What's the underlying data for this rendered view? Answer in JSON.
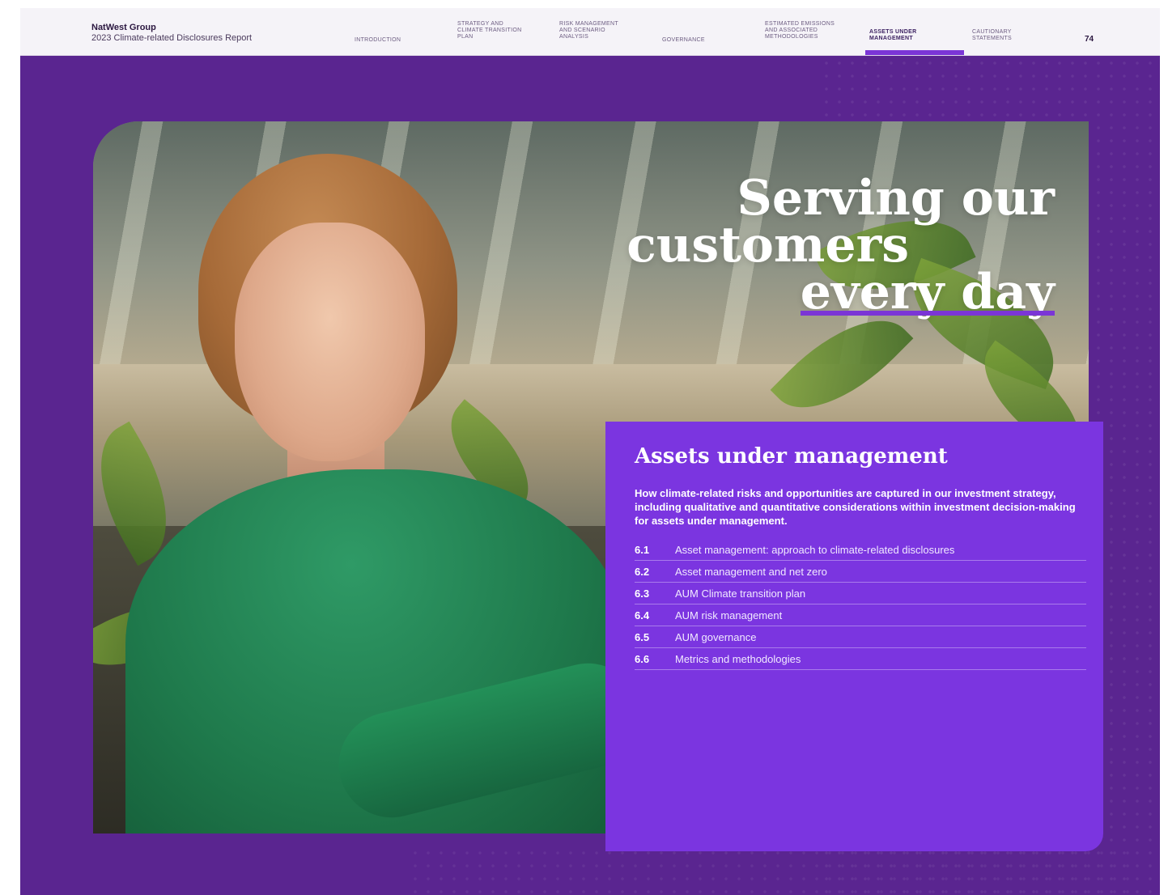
{
  "header": {
    "brand_name": "NatWest Group",
    "report_title": "2023 Climate-related Disclosures Report",
    "page_number": "74",
    "nav": [
      {
        "label": "INTRODUCTION",
        "active": false
      },
      {
        "label": "STRATEGY AND\nCLIMATE TRANSITION\nPLAN",
        "active": false
      },
      {
        "label": "RISK MANAGEMENT\nAND SCENARIO\nANALYSIS",
        "active": false
      },
      {
        "label": "GOVERNANCE",
        "active": false
      },
      {
        "label": "ESTIMATED EMISSIONS\nAND ASSOCIATED\nMETHODOLOGIES",
        "active": false
      },
      {
        "label": "ASSETS UNDER\nMANAGEMENT",
        "active": true
      },
      {
        "label": "CAUTIONARY\nSTATEMENTS",
        "active": false
      }
    ]
  },
  "hero": {
    "headline_line1": "Serving our",
    "headline_line2": "customers",
    "headline_line3": "every day"
  },
  "section": {
    "title": "Assets under management",
    "intro": "How climate-related risks and opportunities are captured in our investment strategy, including qualitative and quantitative considerations within investment decision-making for assets under management.",
    "toc": [
      {
        "num": "6.1",
        "label": "Asset management: approach to climate-related disclosures"
      },
      {
        "num": "6.2",
        "label": "Asset management and net zero"
      },
      {
        "num": "6.3",
        "label": "AUM Climate transition plan"
      },
      {
        "num": "6.4",
        "label": "AUM risk management"
      },
      {
        "num": "6.5",
        "label": "AUM governance"
      },
      {
        "num": "6.6",
        "label": "Metrics and methodologies"
      }
    ]
  },
  "colors": {
    "page_purple": "#5a2590",
    "card_purple": "#7b35e0",
    "accent": "#7b35d6"
  }
}
